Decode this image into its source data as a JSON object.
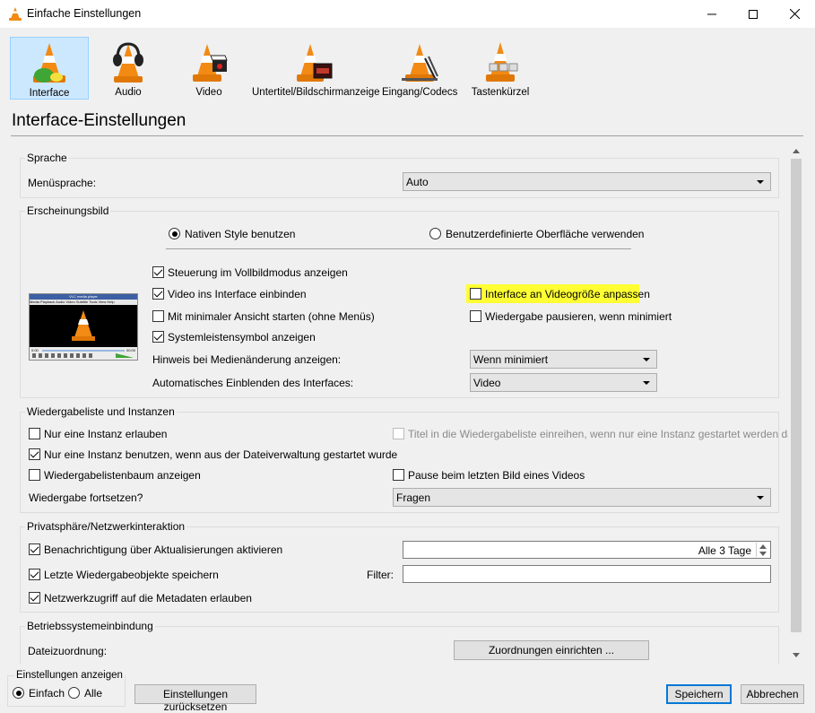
{
  "window": {
    "title": "Einfache Einstellungen"
  },
  "categories": [
    {
      "label": "Interface",
      "icon": "interface-cone-icon",
      "active": true
    },
    {
      "label": "Audio",
      "icon": "audio-cone-headphones-icon"
    },
    {
      "label": "Video",
      "icon": "video-cone-clapper-icon"
    },
    {
      "label": "Untertitel/Bildschirmanzeige",
      "icon": "subtitles-cone-icon"
    },
    {
      "label": "Eingang/Codecs",
      "icon": "input-codecs-cone-icon"
    },
    {
      "label": "Tastenkürzel",
      "icon": "hotkeys-cone-icon"
    }
  ],
  "page_title": "Interface-Einstellungen",
  "sprache": {
    "title": "Sprache",
    "menu_label": "Menüsprache:",
    "menu_value": "Auto"
  },
  "erscheinung": {
    "title": "Erscheinungsbild",
    "native_style": "Nativen Style benutzen",
    "custom_skin": "Benutzerdefinierte Oberfläche verwenden",
    "fullscreen_controls": "Steuerung im Vollbildmodus anzeigen",
    "embed_video": "Video ins Interface einbinden",
    "resize_interface": "Interface an Videogröße anpassen",
    "minimal_view": "Mit minimaler Ansicht starten (ohne Menüs)",
    "pause_minimized": "Wiedergabe pausieren, wenn minimiert",
    "systray": "Systemleistensymbol anzeigen",
    "media_change_label": "Hinweis bei Medienänderung anzeigen:",
    "media_change_value": "Wenn minimiert",
    "auto_raise_label": "Automatisches Einblenden des Interfaces:",
    "auto_raise_value": "Video"
  },
  "playlist": {
    "title": "Wiedergabeliste und Instanzen",
    "one_instance": "Nur eine Instanz erlauben",
    "enqueue": "Titel in die Wiedergabeliste einreihen, wenn nur eine Instanz gestartet werden darf",
    "one_instance_fm": "Nur eine Instanz benutzen, wenn aus der Dateiverwaltung gestartet wurde",
    "tree": "Wiedergabelistenbaum anzeigen",
    "pause_last": "Pause beim letzten Bild eines Videos",
    "resume_label": "Wiedergabe fortsetzen?",
    "resume_value": "Fragen"
  },
  "privacy": {
    "title": "Privatsphäre/Netzwerkinteraktion",
    "updates": "Benachrichtigung über Aktualisierungen aktivieren",
    "updates_value": "Alle 3 Tage",
    "recent": "Letzte Wiedergabeobjekte speichern",
    "filter_label": "Filter:",
    "filter_value": "",
    "metadata": "Netzwerkzugriff auf die Metadaten erlauben"
  },
  "os": {
    "title": "Betriebssystemeinbindung",
    "file_assoc_label": "Dateizuordnung:",
    "file_assoc_button": "Zuordnungen einrichten ..."
  },
  "footer": {
    "show_settings": "Einstellungen anzeigen",
    "simple": "Einfach",
    "all": "Alle",
    "reset": "Einstellungen zurücksetzen",
    "save": "Speichern",
    "cancel": "Abbrechen"
  },
  "preview": {
    "title": "VLC media player",
    "menu": [
      "Media",
      "Playback",
      "Audio",
      "Video",
      "Subtitle",
      "Tools",
      "View",
      "Help"
    ],
    "time_start": "0:00",
    "time_end": "00:00"
  },
  "colors": {
    "accent": "#0078d7",
    "highlight": "#ffff33",
    "active_tab": "#cce8ff",
    "cone_orange": "#f28a14"
  }
}
